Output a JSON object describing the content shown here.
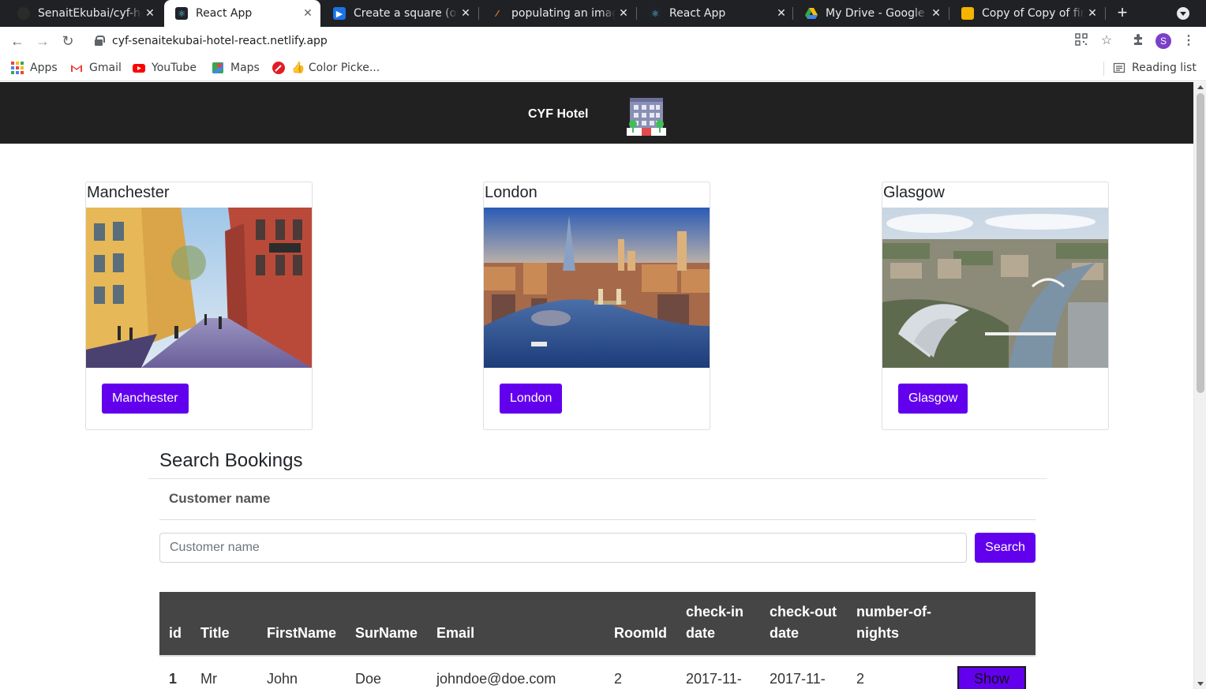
{
  "browser": {
    "tabs": [
      {
        "label": "SenaitEkubai/cyf-hotel",
        "favicon": "github-icon",
        "active": false
      },
      {
        "label": "React App",
        "favicon": "react-icon",
        "active": true
      },
      {
        "label": "Create a square (or rectangle)",
        "favicon": "video-icon",
        "active": false
      },
      {
        "label": "populating an image",
        "favicon": "stackoverflow-icon",
        "active": false
      },
      {
        "label": "React App",
        "favicon": "react-icon",
        "active": false
      },
      {
        "label": "My Drive - Google Drive",
        "favicon": "drive-icon",
        "active": false
      },
      {
        "label": "Copy of Copy of final",
        "favicon": "slides-icon",
        "active": false
      }
    ],
    "url": "cyf-senaitekubai-hotel-react.netlify.app",
    "profile_initial": "S",
    "bookmarks": [
      {
        "label": "Apps",
        "icon": "apps-icon"
      },
      {
        "label": "Gmail",
        "icon": "gmail-icon"
      },
      {
        "label": "YouTube",
        "icon": "youtube-icon"
      },
      {
        "label": "Maps",
        "icon": "maps-icon"
      },
      {
        "label": "👍 Color Picke...",
        "icon": "color-picker-icon"
      }
    ],
    "reading_list": "Reading list"
  },
  "site": {
    "brand": "CYF Hotel",
    "accent": "#6200ee",
    "header_bg": "#212121"
  },
  "cities": [
    {
      "title": "Manchester",
      "button": "Manchester"
    },
    {
      "title": "London",
      "button": "London"
    },
    {
      "title": "Glasgow",
      "button": "Glasgow"
    }
  ],
  "search": {
    "heading": "Search Bookings",
    "label": "Customer name",
    "placeholder": "Customer name",
    "button": "Search"
  },
  "table": {
    "headers": [
      "id",
      "Title",
      "FirstName",
      "SurName",
      "Email",
      "RoomId",
      "check-in date",
      "check-out date",
      "number-of-nights",
      ""
    ],
    "rows": [
      {
        "id": "1",
        "title": "Mr",
        "first": "John",
        "sur": "Doe",
        "email": "johndoe@doe.com",
        "room": "2",
        "checkin": "2017-11-",
        "checkout": "2017-11-",
        "nights": "2",
        "action": "Show"
      }
    ]
  }
}
